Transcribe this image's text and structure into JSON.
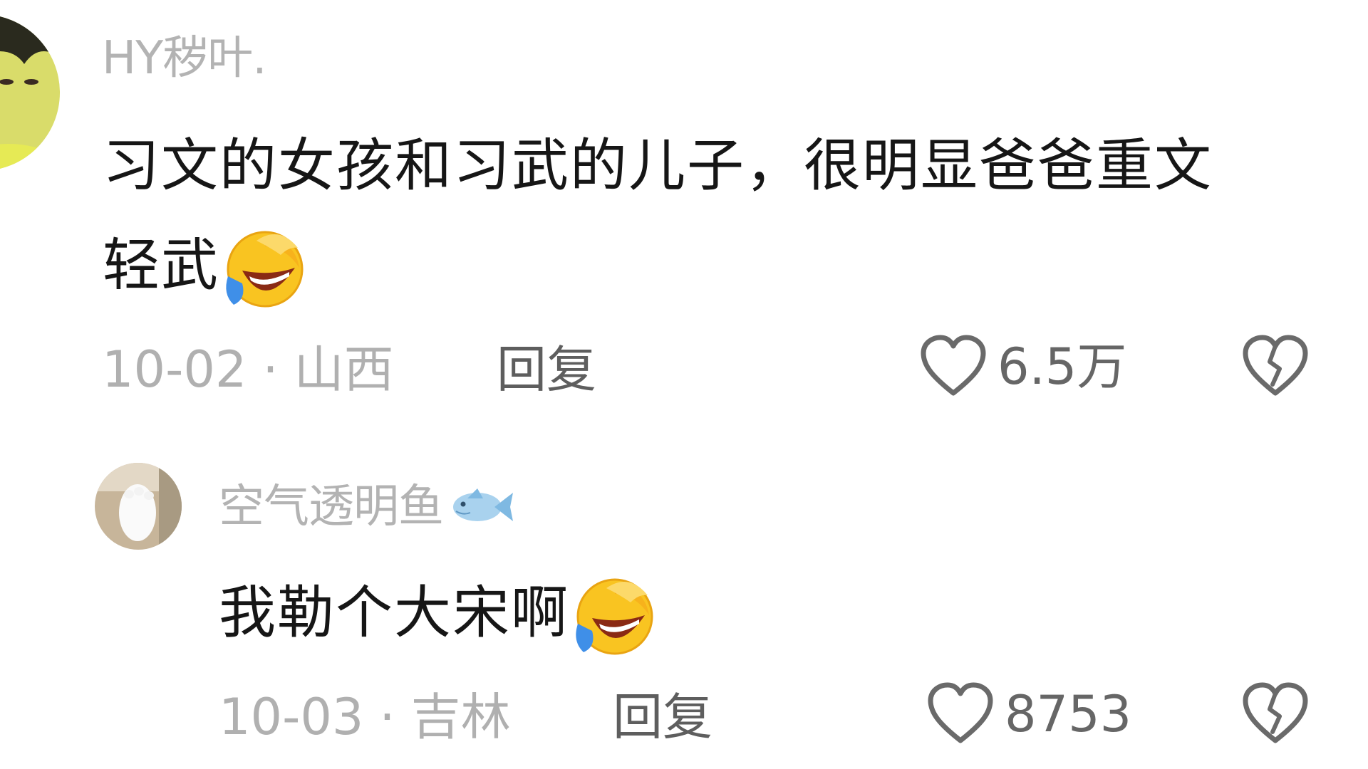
{
  "comments": [
    {
      "username": "HY秽叶.",
      "text_line1": "习文的女孩和习武的儿子，很明显爸爸重文",
      "text_line2": "轻武",
      "emoji": "rolling-on-floor-laughing",
      "date": "10-02",
      "separator": "·",
      "location": "山西",
      "reply_label": "回复",
      "like_count": "6.5万",
      "avatar_icon": "anime-character-avatar"
    },
    {
      "username": "空气透明鱼",
      "username_badge": "fish-icon",
      "text_line1": "我勒个大宋啊",
      "emoji": "rolling-on-floor-laughing",
      "date": "10-03",
      "separator": "·",
      "location": "吉林",
      "reply_label": "回复",
      "like_count": "8753",
      "avatar_icon": "cat-paw-avatar"
    }
  ],
  "colors": {
    "username": "#b3b3b3",
    "text": "#161616",
    "meta": "#b0b0b0",
    "reply": "#5e5e5e",
    "icon_stroke": "#6a6a6a"
  }
}
